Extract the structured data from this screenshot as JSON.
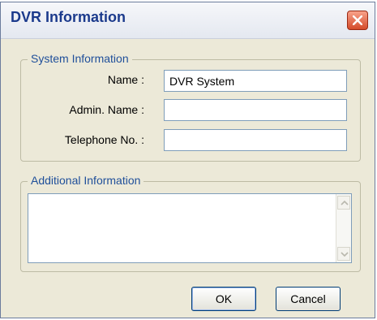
{
  "window": {
    "title": "DVR Information"
  },
  "system_info": {
    "group_label": "System Information",
    "fields": [
      {
        "label": "Name :",
        "value": "DVR System"
      },
      {
        "label": "Admin. Name :",
        "value": ""
      },
      {
        "label": "Telephone No. :",
        "value": ""
      }
    ]
  },
  "additional_info": {
    "group_label": "Additional Information",
    "value": ""
  },
  "buttons": {
    "ok_label": "OK",
    "cancel_label": "Cancel"
  },
  "icons": {
    "close": "close-icon",
    "scroll_up": "scroll-up-arrow-icon",
    "scroll_down": "scroll-down-arrow-icon"
  }
}
